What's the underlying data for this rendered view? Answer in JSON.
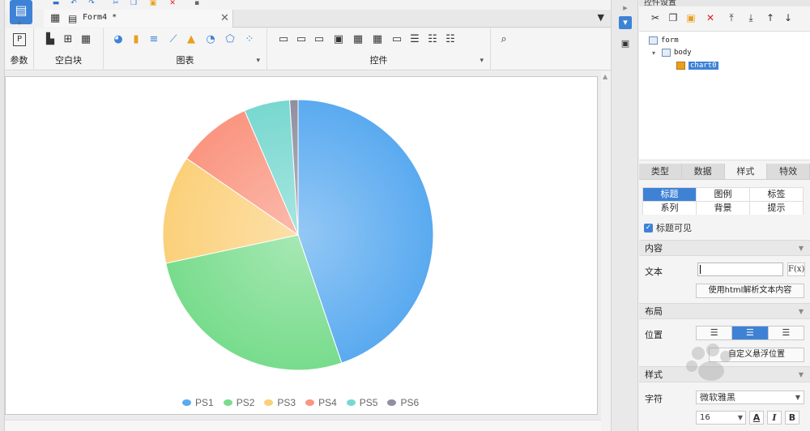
{
  "tab": {
    "title": "Form4 *"
  },
  "ribbon": {
    "groups": [
      {
        "label": "参数"
      },
      {
        "label": "空白块"
      },
      {
        "label": "图表"
      },
      {
        "label": "控件"
      }
    ]
  },
  "chart_data": {
    "type": "pie",
    "categories": [
      "PS1",
      "PS2",
      "PS3",
      "PS4",
      "PS5",
      "PS6"
    ],
    "values": [
      45,
      27,
      13,
      9,
      5.5,
      1.0
    ],
    "colors": [
      "#5aaaf0",
      "#78dc8c",
      "#fbd07a",
      "#fa9580",
      "#78d8d0",
      "#8f8fa0"
    ],
    "legend_position": "bottom"
  },
  "right_panel": {
    "header": "控件设置",
    "tree": {
      "form": "form",
      "body": "body",
      "chart": "chart0"
    },
    "tabs": [
      "类型",
      "数据",
      "样式",
      "特效"
    ],
    "subtabs": [
      "标题",
      "图例",
      "标签",
      "系列",
      "背景",
      "提示"
    ],
    "title_visible": "标题可见",
    "section_content": "内容",
    "text_label": "文本",
    "fx_label": "F(x)",
    "html_button": "使用html解析文本内容",
    "section_layout": "布局",
    "position_label": "位置",
    "float_button": "自定义悬浮位置",
    "section_style": "样式",
    "font_label": "字符",
    "font_value": "微软雅黑",
    "font_size": "16",
    "bold_label": "B",
    "italic_label": "I",
    "color_label": "A"
  }
}
